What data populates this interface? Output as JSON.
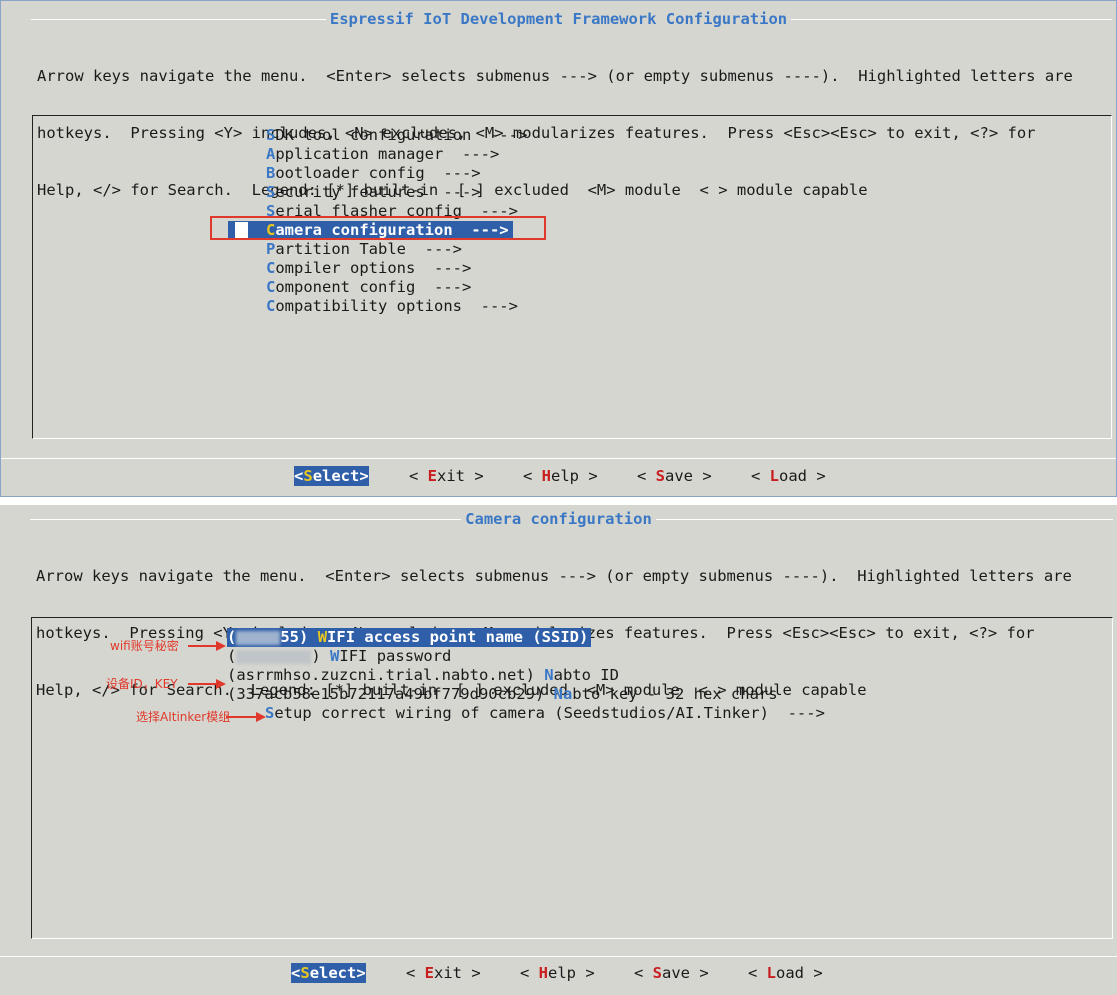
{
  "top": {
    "title": "Espressif IoT Development Framework Configuration",
    "help_lines": [
      "Arrow keys navigate the menu.  <Enter> selects submenus ---> (or empty submenus ----).  Highlighted letters are",
      "hotkeys.  Pressing <Y> includes, <N> excludes, <M> modularizes features.  Press <Esc><Esc> to exit, <?> for",
      "Help, </> for Search.  Legend: [*] built-in  [ ] excluded  <M> module  < > module capable"
    ],
    "items": [
      {
        "hot": "S",
        "rest": "DK tool configuration  --->"
      },
      {
        "hot": "A",
        "rest": "pplication manager  --->"
      },
      {
        "hot": "B",
        "rest": "ootloader config  --->"
      },
      {
        "hot": "S",
        "rest": "ecurity features  --->"
      },
      {
        "hot": "S",
        "rest": "erial flasher config  --->"
      },
      {
        "hot": "C",
        "rest": "amera configuration  --->"
      },
      {
        "hot": "P",
        "rest": "artition Table  --->"
      },
      {
        "hot": "C",
        "rest": "ompiler options  --->"
      },
      {
        "hot": "C",
        "rest": "omponent config  --->"
      },
      {
        "hot": "C",
        "rest": "ompatibility options  --->"
      }
    ],
    "selected_index": 5
  },
  "bottom": {
    "title": "Camera configuration",
    "help_lines": [
      "Arrow keys navigate the menu.  <Enter> selects submenus ---> (or empty submenus ----).  Highlighted letters are",
      "hotkeys.  Pressing <Y> includes, <N> excludes, <M> modularizes features.  Press <Esc><Esc> to exit, <?> for",
      "Help, </> for Search.  Legend: [*] built-in  [ ] excluded  <M> module  < > module capable"
    ],
    "items": [
      {
        "prefix": "(",
        "visible_tail": "55)",
        "hot": "W",
        "rest": "IFI access point name (SSID)"
      },
      {
        "prefix": "(",
        "visible_tail": ")",
        "hot": "W",
        "rest": "IFI password"
      },
      {
        "prefix": "(asrrmhso.zuzcni.trial.nabto.net) ",
        "hot": "N",
        "rest": "abto ID"
      },
      {
        "prefix": "(337acb58e15b72117a49bf779d90cb29) ",
        "hot": "Na",
        "rest": "bto key - 32 hex chars"
      },
      {
        "prefix": "",
        "hot": "S",
        "rest": "etup correct wiring of camera (Seedstudios/AI.Tinker)  --->"
      }
    ],
    "annotations": {
      "wifi": "wifi账号秘密",
      "device": "设备ID，KEY",
      "module": "选择AItinker模组"
    }
  },
  "buttons": {
    "select": {
      "open": "<",
      "hot": "S",
      "rest": "elect>"
    },
    "exit": {
      "open": "< ",
      "hot": "E",
      "rest": "xit >"
    },
    "help": {
      "open": "< ",
      "hot": "H",
      "rest": "elp >"
    },
    "save": {
      "open": "< ",
      "hot": "S",
      "rest": "ave >"
    },
    "load": {
      "open": "< ",
      "hot": "L",
      "rest": "oad >"
    }
  },
  "colors": {
    "terminal_bg": "#d6d6d0",
    "title": "#3a78c6",
    "selection": "#2f5fa8",
    "hotkey_menu": "#3a78c6",
    "hotkey_button": "#c81e1e",
    "annotation": "#e0392b"
  }
}
